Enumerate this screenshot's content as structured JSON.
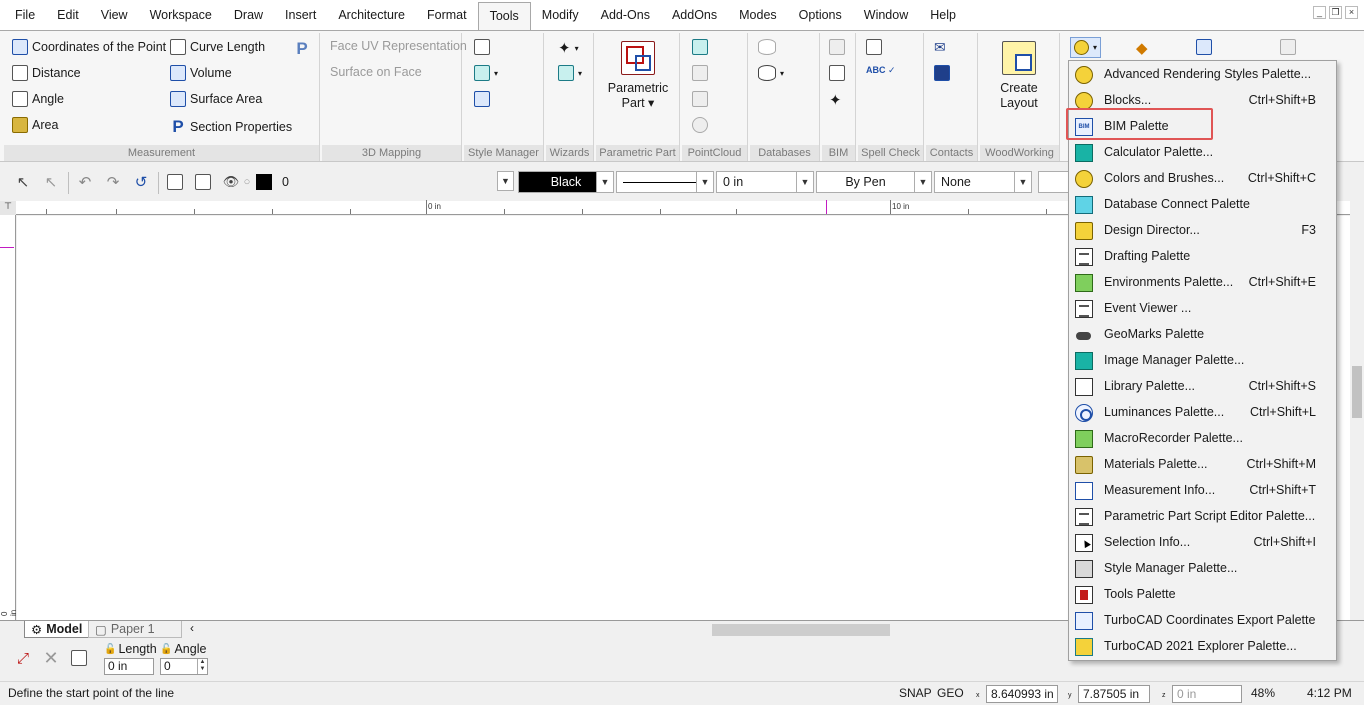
{
  "menu": {
    "items": [
      "File",
      "Edit",
      "View",
      "Workspace",
      "Draw",
      "Insert",
      "Architecture",
      "Format",
      "Tools",
      "Modify",
      "Add-Ons",
      "AddOns",
      "Modes",
      "Options",
      "Window",
      "Help"
    ],
    "active": "Tools"
  },
  "ribbon": {
    "measurement": {
      "label": "Measurement",
      "coordinates": "Coordinates of the Point",
      "distance": "Distance",
      "angle": "Angle",
      "area": "Area",
      "curve_length": "Curve Length",
      "volume": "Volume",
      "surface_area": "Surface Area",
      "section_properties": "Section Properties"
    },
    "mapping": {
      "label": "3D Mapping",
      "face_uv": "Face UV Representation",
      "surface_on_face": "Surface on Face"
    },
    "style_manager": {
      "label": "Style Manager"
    },
    "wizards": {
      "label": "Wizards"
    },
    "parametric_part": {
      "label": "Parametric Part",
      "button_line1": "Parametric",
      "button_line2": "Part ▾"
    },
    "pointcloud": {
      "label": "PointCloud"
    },
    "databases": {
      "label": "Databases"
    },
    "bim": {
      "label": "BIM"
    },
    "spell_check": {
      "label": "Spell Check"
    },
    "contacts": {
      "label": "Contacts"
    },
    "woodworking": {
      "label": "WoodWorking",
      "button_line1": "Create",
      "button_line2": "Layout"
    }
  },
  "toolbar": {
    "layer_value": "0",
    "color_value": "Black",
    "width_value": "0 in",
    "pen_value": "By Pen",
    "pattern_value": "None"
  },
  "ruler": {
    "label_0": "0 in",
    "label_10": "10 in",
    "left_label": "0 in"
  },
  "tabs": {
    "model": "Model",
    "paper": "Paper 1"
  },
  "inspector": {
    "length_label": "Length",
    "angle_label": "Angle",
    "length_value": "0 in",
    "angle_value": "0"
  },
  "status": {
    "prompt": "Define the start point of the line",
    "snap": "SNAP",
    "geo": "GEO",
    "x_value": "8.640993 in",
    "y_value": "7.87505 in",
    "z_value": "0 in",
    "zoom": "48%",
    "time": "4:12 PM"
  },
  "palette_menu": {
    "items": [
      {
        "label": "Advanced Rendering Styles Palette...",
        "shortcut": "",
        "icon": "rendering-styles-icon"
      },
      {
        "label": "Blocks...",
        "shortcut": "Ctrl+Shift+B",
        "icon": "blocks-icon"
      },
      {
        "label": "BIM Palette",
        "shortcut": "",
        "icon": "bim-icon"
      },
      {
        "label": "Calculator Palette...",
        "shortcut": "",
        "icon": "calculator-icon"
      },
      {
        "label": "Colors and Brushes...",
        "shortcut": "Ctrl+Shift+C",
        "icon": "colors-icon"
      },
      {
        "label": "Database Connect Palette",
        "shortcut": "",
        "icon": "database-icon"
      },
      {
        "label": "Design Director...",
        "shortcut": "F3",
        "icon": "design-director-icon"
      },
      {
        "label": "Drafting Palette",
        "shortcut": "",
        "icon": "drafting-icon"
      },
      {
        "label": "Environments Palette...",
        "shortcut": "Ctrl+Shift+E",
        "icon": "environments-icon"
      },
      {
        "label": "Event Viewer ...",
        "shortcut": "",
        "icon": "event-viewer-icon"
      },
      {
        "label": "GeoMarks Palette",
        "shortcut": "",
        "icon": "geomarks-icon"
      },
      {
        "label": "Image Manager Palette...",
        "shortcut": "",
        "icon": "image-manager-icon"
      },
      {
        "label": "Library Palette...",
        "shortcut": "Ctrl+Shift+S",
        "icon": "library-icon"
      },
      {
        "label": "Luminances Palette...",
        "shortcut": "Ctrl+Shift+L",
        "icon": "luminances-icon"
      },
      {
        "label": "MacroRecorder Palette...",
        "shortcut": "",
        "icon": "macro-recorder-icon"
      },
      {
        "label": "Materials Palette...",
        "shortcut": "Ctrl+Shift+M",
        "icon": "materials-icon"
      },
      {
        "label": "Measurement Info...",
        "shortcut": "Ctrl+Shift+T",
        "icon": "measurement-info-icon"
      },
      {
        "label": "Parametric Part Script Editor Palette...",
        "shortcut": "",
        "icon": "script-editor-icon"
      },
      {
        "label": "Selection Info...",
        "shortcut": "Ctrl+Shift+I",
        "icon": "selection-info-icon"
      },
      {
        "label": "Style Manager Palette...",
        "shortcut": "",
        "icon": "style-manager-icon"
      },
      {
        "label": "Tools Palette",
        "shortcut": "",
        "icon": "tools-palette-icon"
      },
      {
        "label": "TurboCAD Coordinates Export Palette",
        "shortcut": "",
        "icon": "coordinates-export-icon"
      },
      {
        "label": "TurboCAD 2021 Explorer Palette...",
        "shortcut": "",
        "icon": "explorer-icon"
      }
    ]
  }
}
